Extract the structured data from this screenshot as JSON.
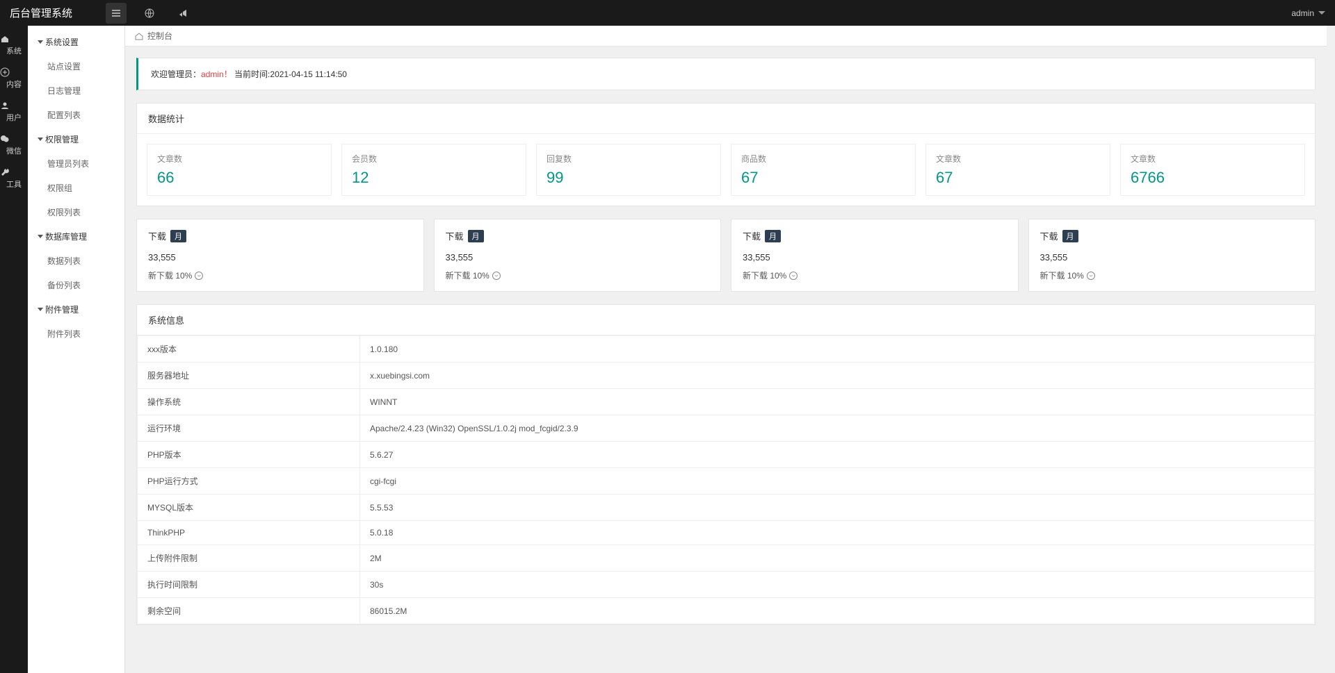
{
  "brand": "后台管理系统",
  "topbar_user": "admin",
  "rail": [
    {
      "icon": "home",
      "label": "系统"
    },
    {
      "icon": "plus",
      "label": "内容"
    },
    {
      "icon": "users",
      "label": "用户"
    },
    {
      "icon": "wechat",
      "label": "微信"
    },
    {
      "icon": "wrench",
      "label": "工具"
    }
  ],
  "sidebar": {
    "groups": [
      {
        "title": "系统设置",
        "items": [
          "站点设置",
          "日志管理",
          "配置列表"
        ]
      },
      {
        "title": "权限管理",
        "items": [
          "管理员列表",
          "权限组",
          "权限列表"
        ]
      },
      {
        "title": "数据库管理",
        "items": [
          "数据列表",
          "备份列表"
        ]
      },
      {
        "title": "附件管理",
        "items": [
          "附件列表"
        ]
      }
    ]
  },
  "breadcrumb": {
    "label": "控制台"
  },
  "welcome": {
    "prefix": "欢迎管理员：",
    "admin": "admin！",
    "time_label": "当前时间:",
    "time": "2021-04-15 11:14:50"
  },
  "stats": {
    "title": "数据统计",
    "cards": [
      {
        "label": "文章数",
        "value": "66"
      },
      {
        "label": "会员数",
        "value": "12"
      },
      {
        "label": "回复数",
        "value": "99"
      },
      {
        "label": "商品数",
        "value": "67"
      },
      {
        "label": "文章数",
        "value": "67"
      },
      {
        "label": "文章数",
        "value": "6766"
      }
    ]
  },
  "downloads": {
    "title": "下载",
    "badge": "月",
    "cards": [
      {
        "count": "33,555",
        "delta": "新下载 10%"
      },
      {
        "count": "33,555",
        "delta": "新下载 10%"
      },
      {
        "count": "33,555",
        "delta": "新下载 10%"
      },
      {
        "count": "33,555",
        "delta": "新下载 10%"
      }
    ]
  },
  "sysinfo": {
    "title": "系统信息",
    "rows": [
      {
        "k": "xxx版本",
        "v": "1.0.180"
      },
      {
        "k": "服务器地址",
        "v": "x.xuebingsi.com"
      },
      {
        "k": "操作系统",
        "v": "WINNT"
      },
      {
        "k": "运行环境",
        "v": "Apache/2.4.23 (Win32) OpenSSL/1.0.2j mod_fcgid/2.3.9"
      },
      {
        "k": "PHP版本",
        "v": "5.6.27"
      },
      {
        "k": "PHP运行方式",
        "v": "cgi-fcgi"
      },
      {
        "k": "MYSQL版本",
        "v": "5.5.53"
      },
      {
        "k": "ThinkPHP",
        "v": "5.0.18"
      },
      {
        "k": "上传附件限制",
        "v": "2M"
      },
      {
        "k": "执行时间限制",
        "v": "30s"
      },
      {
        "k": "剩余空间",
        "v": "86015.2M"
      }
    ]
  }
}
